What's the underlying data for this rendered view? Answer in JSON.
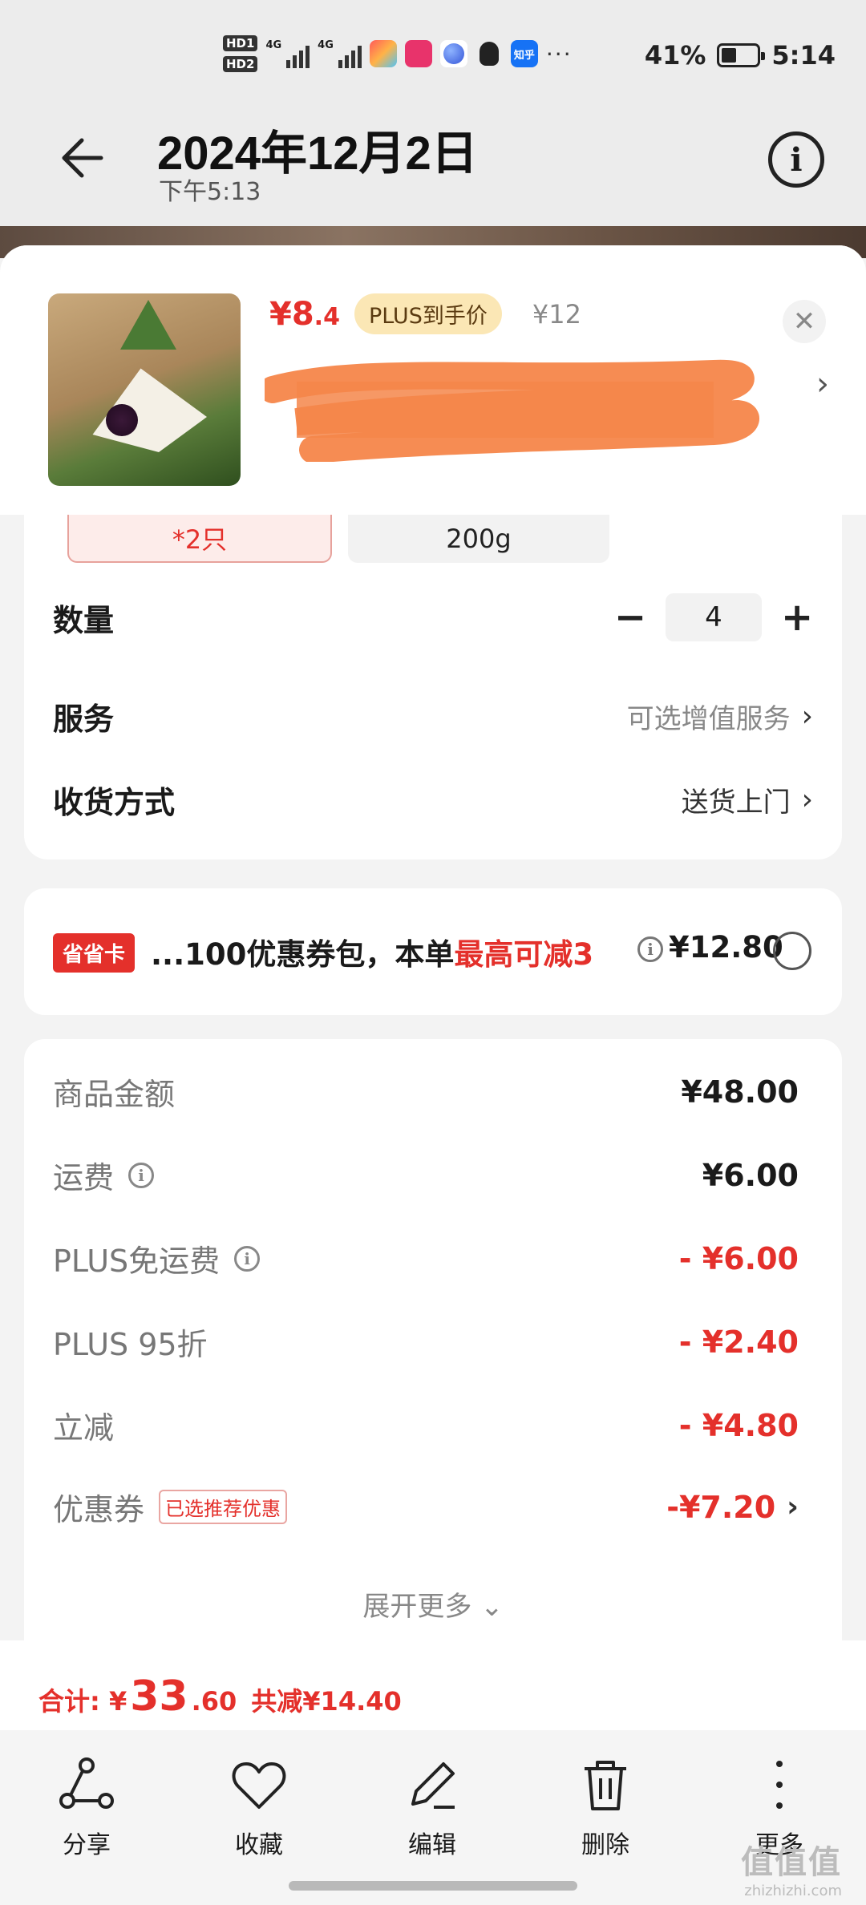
{
  "status_bar": {
    "hd1": "HD1",
    "hd2": "HD2",
    "net1": "4G",
    "net2": "4G",
    "app_icons": [
      "flag-app-icon",
      "shopping-app-icon",
      "browser-app-icon",
      "qq-icon",
      "zhihu-icon"
    ],
    "zhihu_label": "知乎",
    "more": "···",
    "battery": "41%",
    "time": "5:14"
  },
  "header": {
    "title": "2024年12月2日",
    "subtitle": "下午5:13"
  },
  "product": {
    "price_main": "¥8",
    "price_decimal": ".4",
    "plus_label": "PLUS到手价",
    "original_price": "¥12"
  },
  "variants": {
    "selected": "*2只",
    "other": "200g"
  },
  "options": {
    "quantity_label": "数量",
    "quantity_value": "4",
    "minus": "−",
    "plus": "+",
    "service_label": "服务",
    "service_value": "可选增值服务",
    "delivery_label": "收货方式",
    "delivery_value": "送货上门"
  },
  "saver_card": {
    "tag": "省省卡",
    "text_prefix": "...100优惠券包，本单",
    "text_highlight": "最高可减3",
    "info": "i",
    "amount": "¥12.80"
  },
  "summary": {
    "rows": [
      {
        "label": "商品金额",
        "value": "¥48.00"
      },
      {
        "label": "运费",
        "value": "¥6.00"
      },
      {
        "label": "PLUS免运费",
        "value": "- ¥6.00"
      },
      {
        "label": "PLUS 95折",
        "value": "- ¥2.40"
      },
      {
        "label": "立减",
        "value": "- ¥4.80"
      },
      {
        "label": "优惠券",
        "badge": "已选推荐优惠",
        "value": "-¥7.20"
      }
    ],
    "expand": "展开更多"
  },
  "total": {
    "label": "合计: ¥",
    "amount_big": "33",
    "amount_small": ".60",
    "saved": "共减¥14.40"
  },
  "actions": {
    "share": "分享",
    "favorite": "收藏",
    "edit": "编辑",
    "delete": "删除",
    "more": "更多"
  },
  "watermark": {
    "main": "值值值",
    "sub": "zhizhizhi.com"
  },
  "colors": {
    "accent_red": "#e4302b",
    "plus_gold": "#fbe7b5",
    "redaction_orange": "#f5864a"
  }
}
